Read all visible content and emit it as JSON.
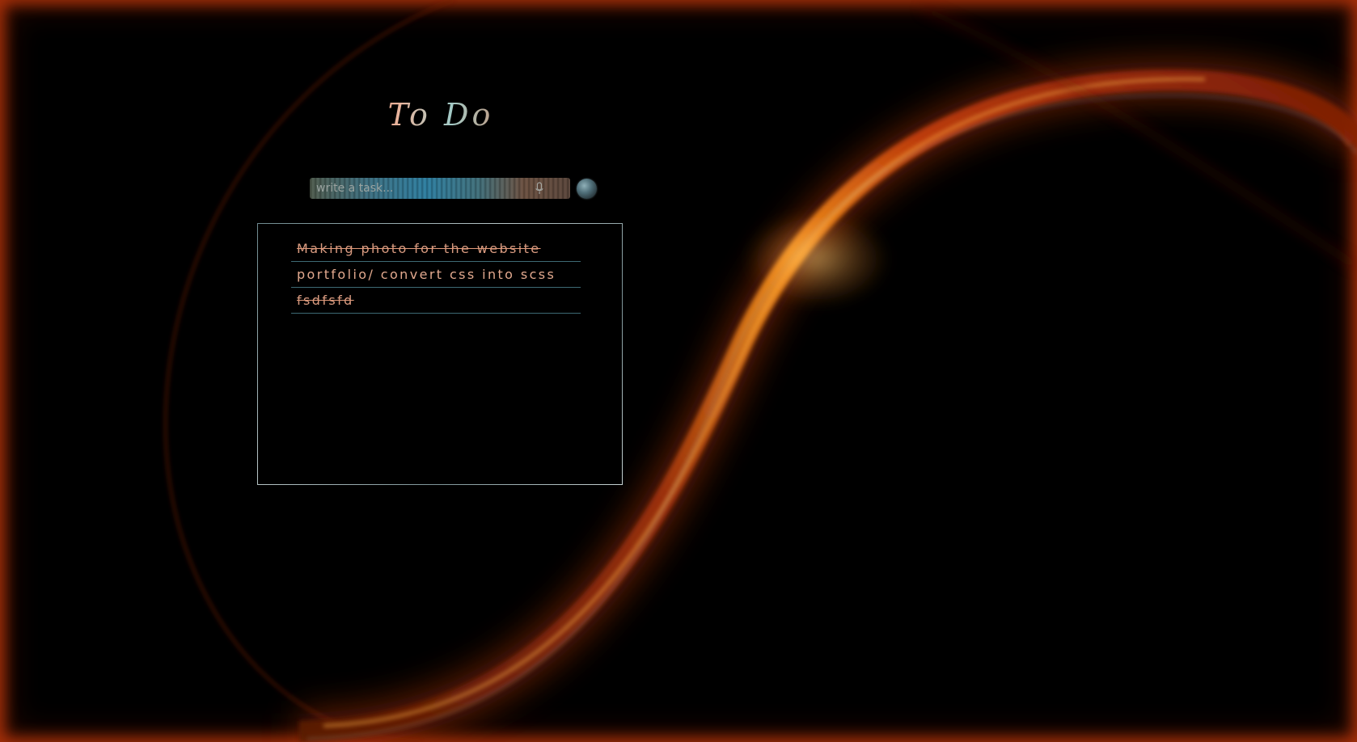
{
  "app": {
    "title": "To Do"
  },
  "input": {
    "placeholder": "write a task...",
    "value": ""
  },
  "icons": {
    "mic": "mic-icon",
    "add": "add-task-button"
  },
  "tasks": [
    {
      "text": "Making photo for the website",
      "completed": true
    },
    {
      "text": "portfolio/ convert css into scss",
      "completed": false
    },
    {
      "text": "fsdfsfd",
      "completed": true
    }
  ],
  "colors": {
    "frame_glow": "#be370a",
    "task_text": "#e2a98e",
    "divider": "#3d6a74",
    "background": "#000000"
  }
}
